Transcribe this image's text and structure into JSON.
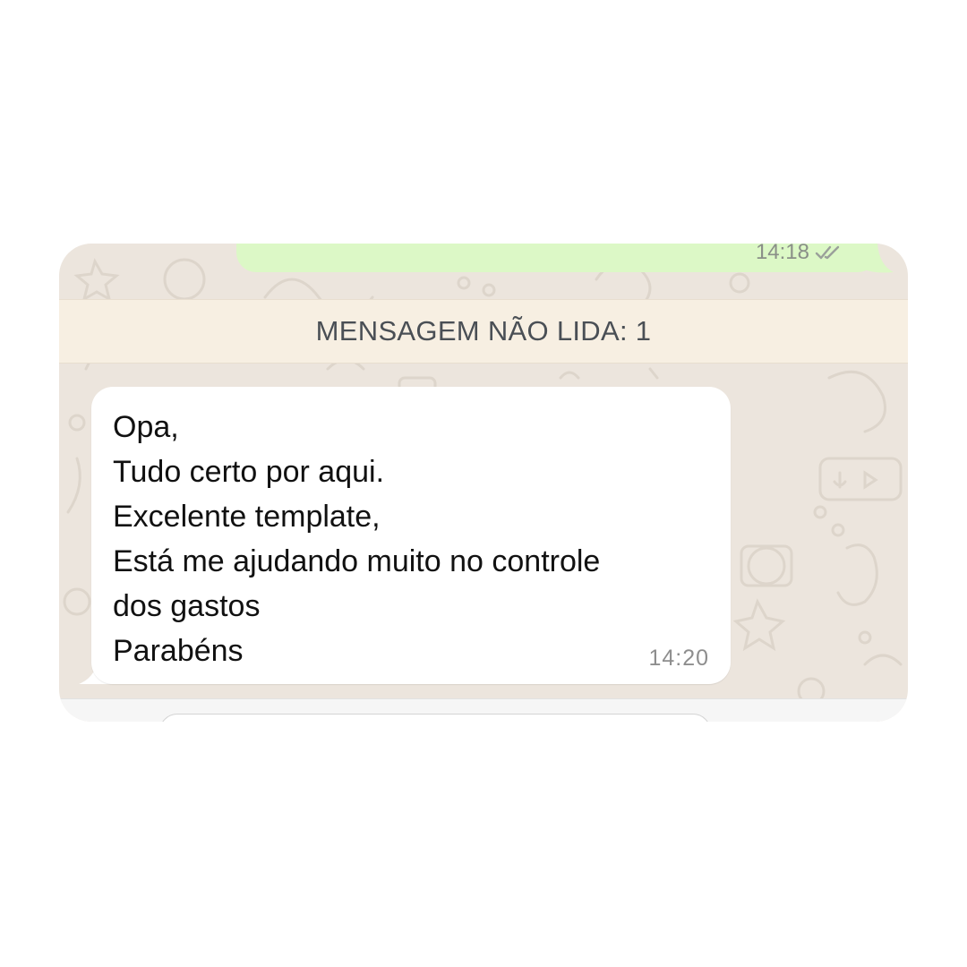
{
  "chat": {
    "outgoing_message": {
      "time": "14:18",
      "status_icon": "double-check-icon"
    },
    "unread_banner": {
      "text": "MENSAGEM NÃO LIDA: 1"
    },
    "incoming_message": {
      "lines": [
        "Opa,",
        "Tudo certo por aqui.",
        "Excelente template,",
        "Está me ajudando muito no controle",
        "dos gastos",
        "Parabéns"
      ],
      "time": "14:20"
    },
    "input": {
      "placeholder": ""
    }
  },
  "colors": {
    "wallpaper": "#ece5dd",
    "outgoing_bubble": "#dcf8c6",
    "incoming_bubble": "#ffffff",
    "unread_banner": "#f7efe2"
  }
}
